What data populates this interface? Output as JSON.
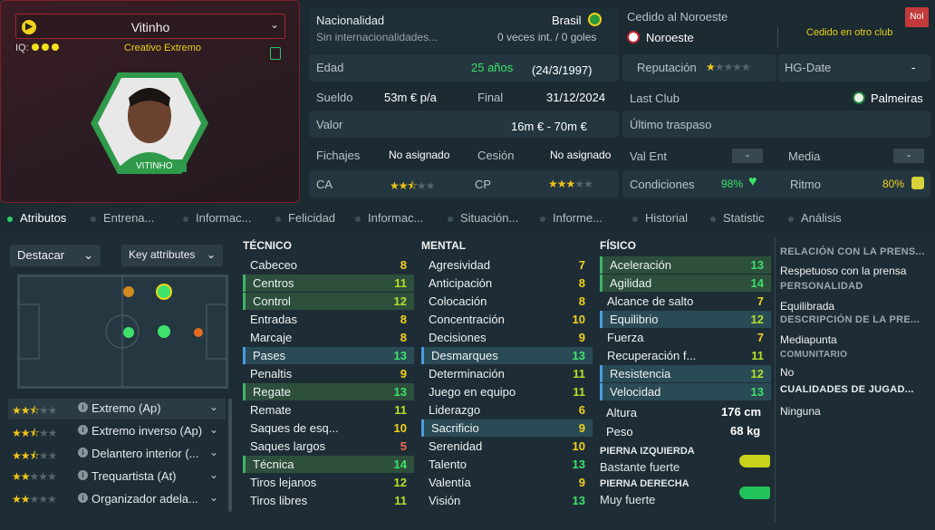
{
  "player": {
    "name": "Vitinho",
    "iq_label": "IQ:",
    "role": "Creativo Extremo",
    "shirt_name": "VITINHO"
  },
  "info": {
    "nat_label": "Nacionalidad",
    "nat_value": "Brasil",
    "nat_sub": "Sin internacionalidades...",
    "nat_caps": "0 veces int. / 0 goles",
    "loan_label": "Cedido al Noroeste",
    "loan_badge": "NoI",
    "loan_club": "Noroeste",
    "loan_other": "Cedido en otro club",
    "age_label": "Edad",
    "age_value": "25 años",
    "age_date": "(24/3/1997)",
    "rep_label": "Reputación",
    "hg_label": "HG-Date",
    "hg_value": "-",
    "wage_label": "Sueldo",
    "wage_value": "53m € p/a",
    "end_label": "Final",
    "end_value": "31/12/2024",
    "lastclub_label": "Last Club",
    "lastclub_value": "Palmeiras",
    "value_label": "Valor",
    "value_value": "16m € - 70m €",
    "lasttransfer_label": "Último traspaso",
    "signings_label": "Fichajes",
    "signings_value": "No asignado",
    "loanout_label": "Cesión",
    "loanout_value": "No asignado",
    "valent_label": "Val Ent",
    "valent_value": "-",
    "media_label": "Media",
    "media_value": "-",
    "ca_label": "CA",
    "cp_label": "CP",
    "cond_label": "Condiciones",
    "cond_value": "98%",
    "rhythm_label": "Ritmo",
    "rhythm_value": "80%"
  },
  "stars": {
    "reputation": 1,
    "ca": 2.5,
    "cp": 3
  },
  "tabs": [
    "Atributos",
    "Entrena...",
    "Informac...",
    "Felicidad",
    "Informac...",
    "Situación...",
    "Informe...",
    "Historial",
    "Statistic",
    "Análisis"
  ],
  "left": {
    "highlight_label": "Destacar",
    "key_label": "Key attributes"
  },
  "roles": [
    {
      "name": "Extremo (Ap)",
      "stars": 2.5
    },
    {
      "name": "Extremo inverso (Ap)",
      "stars": 2.5
    },
    {
      "name": "Delantero interior (...",
      "stars": 2.5
    },
    {
      "name": "Trequartista (At)",
      "stars": 2
    },
    {
      "name": "Organizador adela...",
      "stars": 2
    }
  ],
  "tecnico": {
    "title": "TÉCNICO",
    "items": [
      {
        "n": "Cabeceo",
        "v": "8"
      },
      {
        "n": "Centros",
        "v": "11"
      },
      {
        "n": "Control",
        "v": "12"
      },
      {
        "n": "Entradas",
        "v": "8"
      },
      {
        "n": "Marcaje",
        "v": "8"
      },
      {
        "n": "Pases",
        "v": "13"
      },
      {
        "n": "Penaltis",
        "v": "9"
      },
      {
        "n": "Regate",
        "v": "13"
      },
      {
        "n": "Remate",
        "v": "11"
      },
      {
        "n": "Saques de esq...",
        "v": "10"
      },
      {
        "n": "Saques largos",
        "v": "5"
      },
      {
        "n": "Técnica",
        "v": "14"
      },
      {
        "n": "Tiros lejanos",
        "v": "12"
      },
      {
        "n": "Tiros libres",
        "v": "11"
      }
    ]
  },
  "mental": {
    "title": "MENTAL",
    "items": [
      {
        "n": "Agresividad",
        "v": "7"
      },
      {
        "n": "Anticipación",
        "v": "8"
      },
      {
        "n": "Colocación",
        "v": "8"
      },
      {
        "n": "Concentración",
        "v": "10"
      },
      {
        "n": "Decisiones",
        "v": "9"
      },
      {
        "n": "Desmarques",
        "v": "13"
      },
      {
        "n": "Determinación",
        "v": "11"
      },
      {
        "n": "Juego en equipo",
        "v": "11"
      },
      {
        "n": "Liderazgo",
        "v": "6"
      },
      {
        "n": "Sacrificio",
        "v": "9"
      },
      {
        "n": "Serenidad",
        "v": "10"
      },
      {
        "n": "Talento",
        "v": "13"
      },
      {
        "n": "Valentía",
        "v": "9"
      },
      {
        "n": "Visión",
        "v": "13"
      }
    ]
  },
  "fisico": {
    "title": "FÍSICO",
    "items": [
      {
        "n": "Aceleración",
        "v": "13"
      },
      {
        "n": "Agilidad",
        "v": "14"
      },
      {
        "n": "Alcance de salto",
        "v": "7"
      },
      {
        "n": "Equilibrio",
        "v": "12"
      },
      {
        "n": "Fuerza",
        "v": "7"
      },
      {
        "n": "Recuperación f...",
        "v": "11"
      },
      {
        "n": "Resistencia",
        "v": "12"
      },
      {
        "n": "Velocidad",
        "v": "13"
      }
    ],
    "height_label": "Altura",
    "height_value": "176 cm",
    "weight_label": "Peso",
    "weight_value": "68 kg",
    "leftfoot_label": "PIERNA IZQUIERDA",
    "leftfoot_value": "Bastante fuerte",
    "rightfoot_label": "PIERNA DERECHA",
    "rightfoot_value": "Muy fuerte"
  },
  "right": {
    "press_head": "RELACIÓN CON LA PRENS...",
    "press_value": "Respetuoso con la prensa",
    "pers_head": "PERSONALIDAD",
    "pers_value": "Equilibrada",
    "desc_head": "DESCRIPCIÓN DE LA PRE...",
    "desc_value": "Mediapunta",
    "com_head": "COMUNITARIO",
    "com_value": "No",
    "qual_head": "CUALIDADES DE JUGAD...",
    "qual_value": "Ninguna"
  },
  "colors": {
    "accent": "#2fd06a",
    "card_border": "#7d1e2c"
  }
}
